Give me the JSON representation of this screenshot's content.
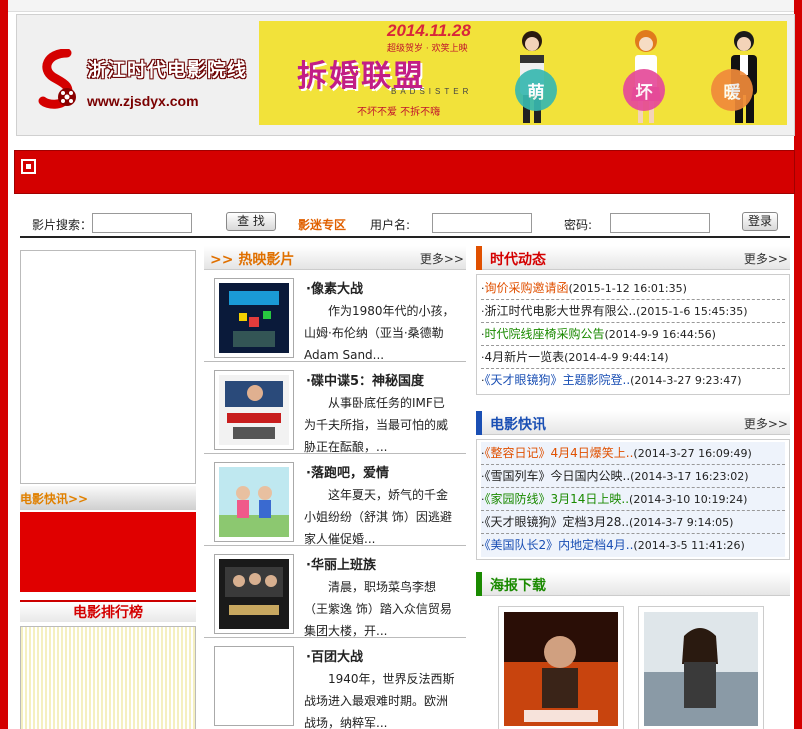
{
  "header": {
    "logo_title": "浙江时代电影院线",
    "logo_url": "www.zjsdyx.com",
    "banner": {
      "date": "2014.11.28",
      "subtitle": "超级贺岁 · 欢笑上映",
      "title": "拆婚联盟",
      "title_en": "BADSISTER",
      "slogan": "不坏不爱 不拆不嗨",
      "tags": [
        "萌",
        "坏",
        "暖"
      ]
    }
  },
  "search": {
    "label": "影片搜索：",
    "button": "查 找",
    "zone_link": "影迷专区",
    "username_label": "用户名:",
    "password_label": "密码:",
    "login_button": "登录"
  },
  "left": {
    "news_title": "电影快讯>>",
    "rank_title": "电影排行榜"
  },
  "hot": {
    "title": ">> 热映影片",
    "more": "更多>>",
    "movies": [
      {
        "title": "·像素大战",
        "desc": "作为1980年代的小孩，山姆·布伦纳（亚当·桑德勒 Adam Sand..."
      },
      {
        "title": "·碟中谍5：神秘国度",
        "desc": "从事卧底任务的IMF已为千夫所指，当最可怕的威胁正在酝酿，..."
      },
      {
        "title": "·落跑吧，爱情",
        "desc": "这年夏天，娇气的千金小姐纷纷（舒淇 饰）因逃避家人催促婚..."
      },
      {
        "title": "·华丽上班族",
        "desc": "清晨，职场菜鸟李想（王紫逸 饰）踏入众信贸易集团大楼，开..."
      },
      {
        "title": "·百团大战",
        "desc": "1940年，世界反法西斯战场进入最艰难时期。欧洲战场，纳粹军..."
      }
    ]
  },
  "news": {
    "title": "时代动态",
    "more": "更多>>",
    "items": [
      {
        "title": "询价采购邀请函",
        "date": "(2015-1-12 16:01:35)",
        "color": "#e05000"
      },
      {
        "title": "浙江时代电影大世界有限公..",
        "date": "(2015-1-6 15:45:35)",
        "color": "#222222"
      },
      {
        "title": "时代院线座椅采购公告",
        "date": "(2014-9-9 16:44:56)",
        "color": "#1a8a00"
      },
      {
        "title": "4月新片一览表",
        "date": "(2014-4-9 9:44:14)",
        "color": "#222222"
      },
      {
        "title": "《天才眼镜狗》主题影院登..",
        "date": "(2014-3-27 9:23:47)",
        "color": "#1a4fb4"
      }
    ]
  },
  "express": {
    "title": "电影快讯",
    "more": "更多>>",
    "items": [
      {
        "title": "《整容日记》4月4日爆笑上..",
        "date": "(2014-3-27 16:09:49)",
        "color": "#e05000"
      },
      {
        "title": "《雪国列车》今日国内公映..",
        "date": "(2014-3-17 16:23:02)",
        "color": "#222222"
      },
      {
        "title": "《家园防线》3月14日上映..",
        "date": "(2014-3-10 10:19:24)",
        "color": "#1a8a00"
      },
      {
        "title": "《天才眼镜狗》定档3月28..",
        "date": "(2014-3-7 9:14:05)",
        "color": "#222222"
      },
      {
        "title": "《美国队长2》内地定档4月..",
        "date": "(2014-3-5 11:41:26)",
        "color": "#1a4fb4"
      }
    ]
  },
  "poster": {
    "title": "海报下载"
  },
  "colors": {
    "brand_red": "#d40000",
    "accent_orange": "#e07000",
    "news_accent": "#e05000",
    "express_accent": "#1a4fb4",
    "poster_accent": "#1a8a00"
  }
}
